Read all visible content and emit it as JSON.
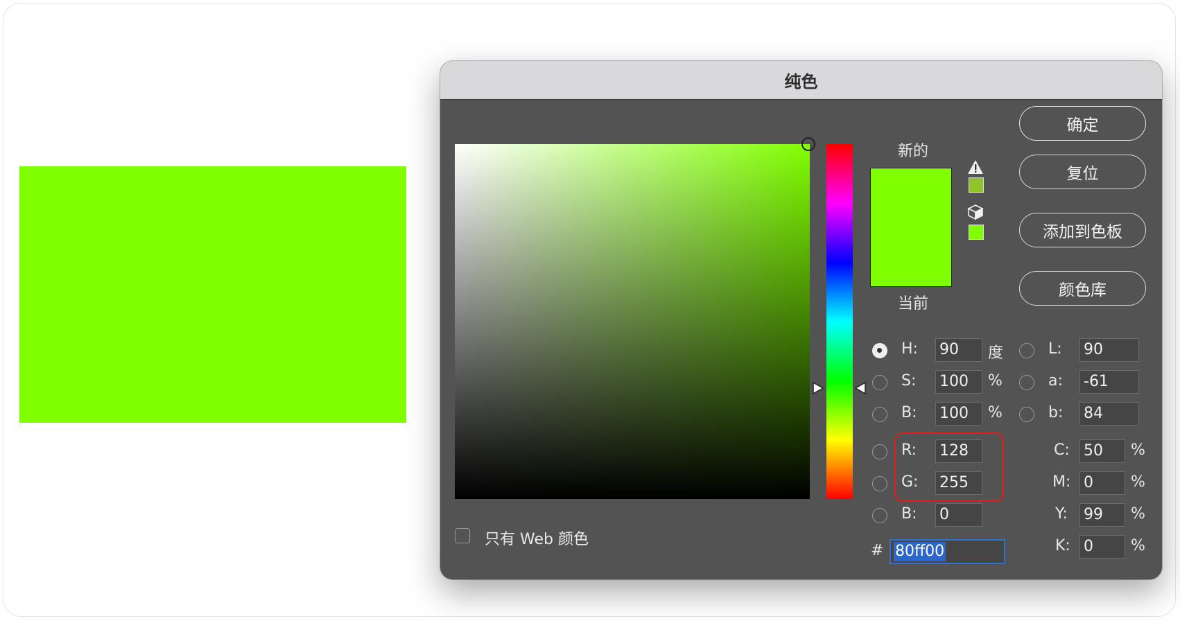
{
  "colors": {
    "preview": "#80ff00",
    "dialog_bg": "#535353",
    "highlight": "#e21b1b"
  },
  "dialog": {
    "title": "纯色",
    "buttons": {
      "ok": "确定",
      "reset": "复位",
      "add_to_swatches": "添加到色板",
      "color_libraries": "颜色库"
    },
    "swatch": {
      "new_label": "新的",
      "current_label": "当前",
      "new_color": "#80ff00",
      "current_color": "#80ff00"
    },
    "gamut_icons": {
      "warning_icon": "warning-triangle-icon",
      "web_cube_icon": "cube-icon"
    },
    "web_only_label": "只有 Web 颜色",
    "fields": {
      "H": {
        "label": "H:",
        "value": "90",
        "unit": "度",
        "selected": true
      },
      "S": {
        "label": "S:",
        "value": "100",
        "unit": "%"
      },
      "Bv": {
        "label": "B:",
        "value": "100",
        "unit": "%"
      },
      "R": {
        "label": "R:",
        "value": "128"
      },
      "G": {
        "label": "G:",
        "value": "255"
      },
      "Bc": {
        "label": "B:",
        "value": "0"
      },
      "L": {
        "label": "L:",
        "value": "90"
      },
      "a": {
        "label": "a:",
        "value": "-61"
      },
      "b": {
        "label": "b:",
        "value": "84"
      },
      "C": {
        "label": "C:",
        "value": "50",
        "unit": "%"
      },
      "M": {
        "label": "M:",
        "value": "0",
        "unit": "%"
      },
      "Y": {
        "label": "Y:",
        "value": "99",
        "unit": "%"
      },
      "K": {
        "label": "K:",
        "value": "0",
        "unit": "%"
      }
    },
    "hex": {
      "label": "#",
      "value": "80ff00"
    }
  }
}
